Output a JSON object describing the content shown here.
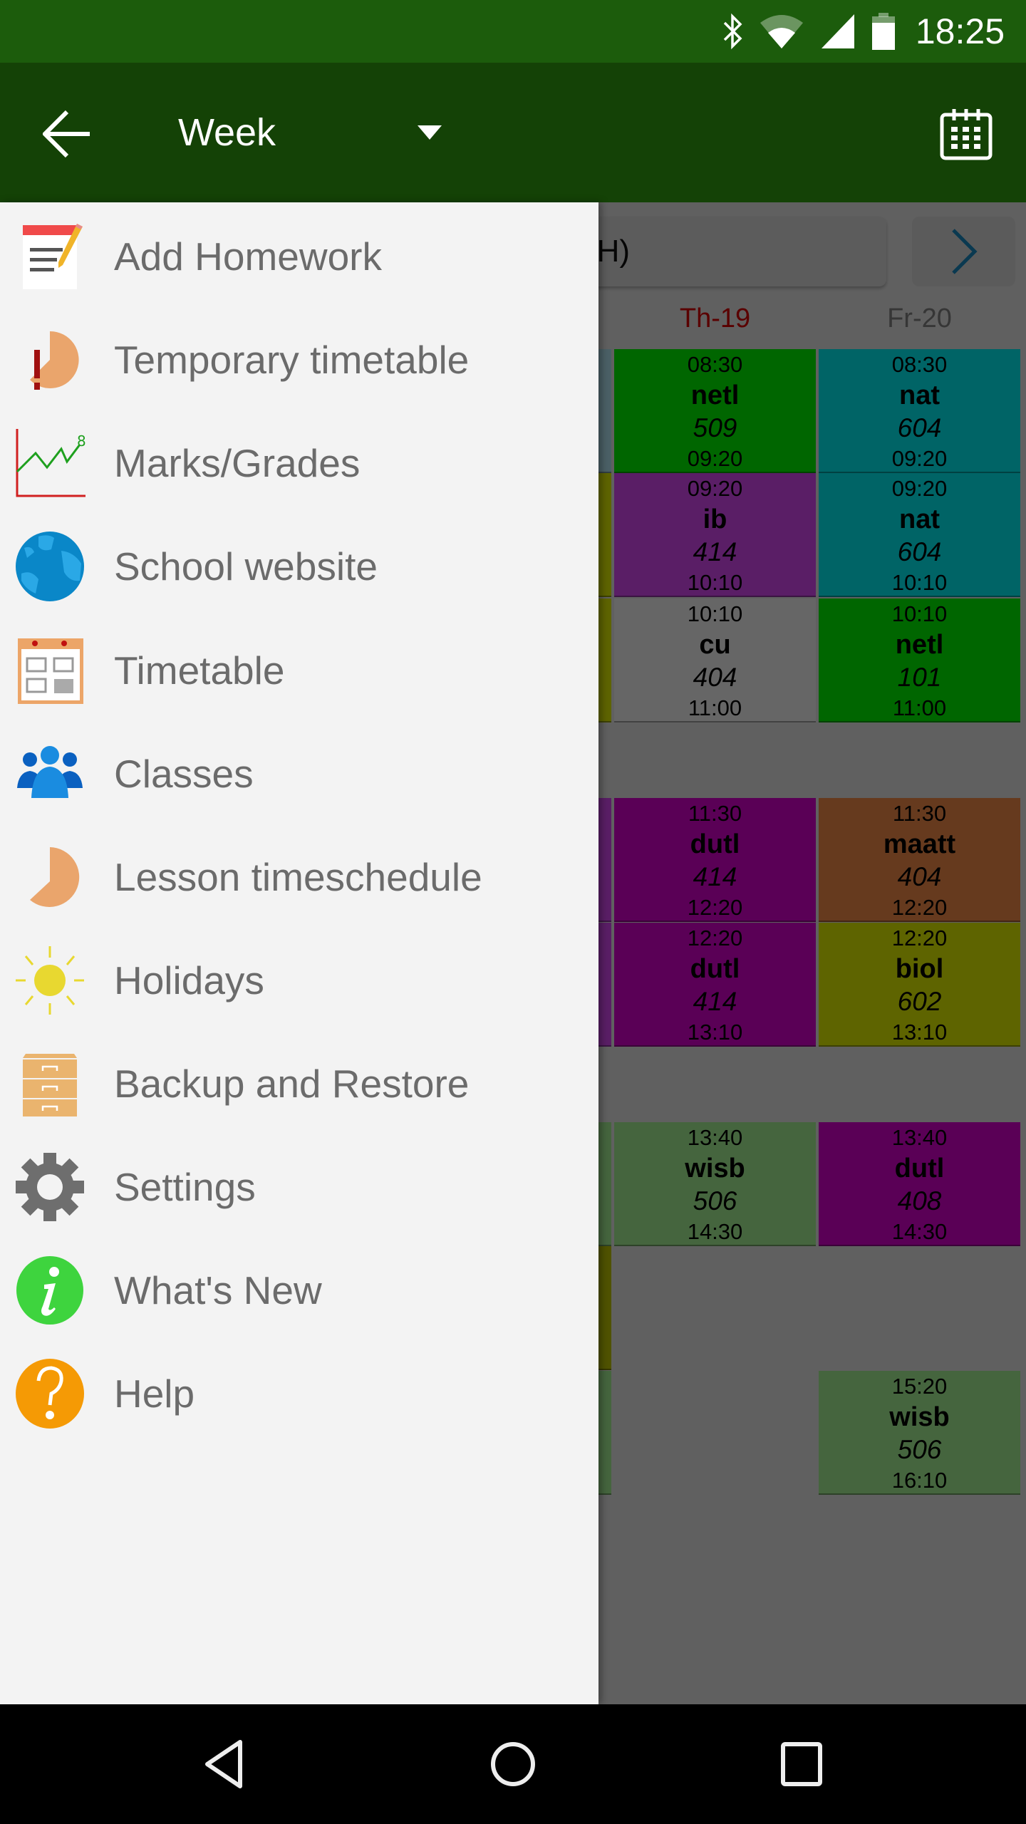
{
  "status_bar": {
    "time": "18:25",
    "icons": [
      "bluetooth-icon",
      "wifi-icon",
      "cell-signal-icon",
      "battery-icon"
    ]
  },
  "toolbar": {
    "back_icon": "arrow-back-icon",
    "view_selector": {
      "selected": "Week"
    },
    "calendar_icon": "calendar-icon"
  },
  "timetable": {
    "week_title_visible": "CH)",
    "next_icon": "chevron-right-icon",
    "days": [
      {
        "label": "Th-19",
        "is_today": true
      },
      {
        "label": "Fr-20",
        "is_today": false
      }
    ],
    "lessons": [
      {
        "day": 0,
        "slot": 0,
        "start": "08:30",
        "subject": "netl",
        "room": "509",
        "end": "09:20",
        "color": "#00ff00"
      },
      {
        "day": 0,
        "slot": 1,
        "start": "09:20",
        "subject": "ib",
        "room": "414",
        "end": "10:10",
        "color": "#e14dff"
      },
      {
        "day": 0,
        "slot": 2,
        "start": "10:10",
        "subject": "cu",
        "room": "404",
        "end": "11:00",
        "color": "#ffffff"
      },
      {
        "day": 0,
        "slot": 3,
        "start": "11:30",
        "subject": "dutl",
        "room": "414",
        "end": "12:20",
        "color": "#e000d8"
      },
      {
        "day": 0,
        "slot": 4,
        "start": "12:20",
        "subject": "dutl",
        "room": "414",
        "end": "13:10",
        "color": "#e000d8"
      },
      {
        "day": 0,
        "slot": 5,
        "start": "13:40",
        "subject": "wisb",
        "room": "506",
        "end": "14:30",
        "color": "#adfd9b"
      },
      {
        "day": 1,
        "slot": 0,
        "start": "08:30",
        "subject": "nat",
        "room": "604",
        "end": "09:20",
        "color": "#00faff"
      },
      {
        "day": 1,
        "slot": 1,
        "start": "09:20",
        "subject": "nat",
        "room": "604",
        "end": "10:10",
        "color": "#00faff"
      },
      {
        "day": 1,
        "slot": 2,
        "start": "10:10",
        "subject": "netl",
        "room": "101",
        "end": "11:00",
        "color": "#00ff00"
      },
      {
        "day": 1,
        "slot": 3,
        "start": "11:30",
        "subject": "maatt",
        "room": "404",
        "end": "12:20",
        "color": "#ff914b"
      },
      {
        "day": 1,
        "slot": 4,
        "start": "12:20",
        "subject": "biol",
        "room": "602",
        "end": "13:10",
        "color": "#ebfa00"
      },
      {
        "day": 1,
        "slot": 5,
        "start": "13:40",
        "subject": "dutl",
        "room": "408",
        "end": "14:30",
        "color": "#e000d8"
      },
      {
        "day": 1,
        "slot": 7,
        "start": "15:20",
        "subject": "wisb",
        "room": "506",
        "end": "16:10",
        "color": "#adfd9b"
      }
    ],
    "partial_column_colors": [
      "#bcf0ff",
      "#ebfa00",
      "#ebfa00",
      "#e14dff",
      "#e14dff",
      "#adfd9b",
      "#c8d000",
      "#adfd9b"
    ]
  },
  "drawer": {
    "items": [
      {
        "label": "Add Homework",
        "icon": "homework-notepad-icon"
      },
      {
        "label": "Temporary timetable",
        "icon": "temporary-timetable-icon"
      },
      {
        "label": "Marks/Grades",
        "icon": "grades-chart-icon"
      },
      {
        "label": "School website",
        "icon": "globe-icon"
      },
      {
        "label": "Timetable",
        "icon": "timetable-icon"
      },
      {
        "label": "Classes",
        "icon": "people-icon"
      },
      {
        "label": "Lesson timeschedule",
        "icon": "clock-pie-icon"
      },
      {
        "label": "Holidays",
        "icon": "sun-icon"
      },
      {
        "label": "Backup and Restore",
        "icon": "cabinet-icon"
      },
      {
        "label": "Settings",
        "icon": "gear-icon"
      },
      {
        "label": "What's New",
        "icon": "info-icon"
      },
      {
        "label": "Help",
        "icon": "help-icon"
      }
    ]
  },
  "nav_bar": {
    "back": "nav-back-icon",
    "home": "nav-home-icon",
    "recents": "nav-recents-icon"
  }
}
